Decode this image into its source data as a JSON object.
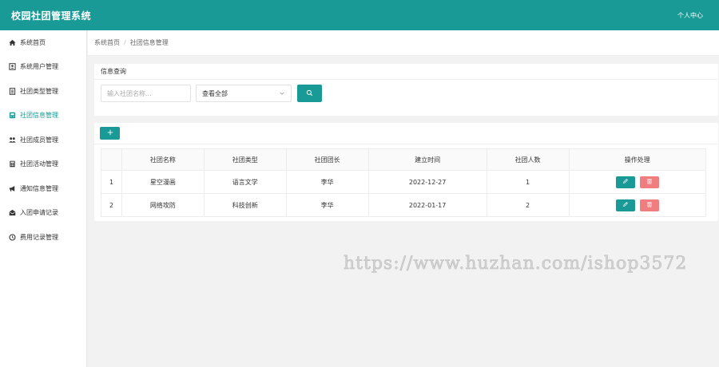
{
  "header": {
    "title": "校园社团管理系统",
    "user_link": "个人中心"
  },
  "sidebar": {
    "items": [
      {
        "label": "系统首页",
        "icon": "home-icon"
      },
      {
        "label": "系统用户管理",
        "icon": "user-card-icon"
      },
      {
        "label": "社团类型管理",
        "icon": "document-icon"
      },
      {
        "label": "社团信息管理",
        "icon": "info-icon",
        "active": true
      },
      {
        "label": "社团成员管理",
        "icon": "group-icon"
      },
      {
        "label": "社团活动管理",
        "icon": "calculator-icon"
      },
      {
        "label": "通知信息管理",
        "icon": "bullhorn-icon"
      },
      {
        "label": "入团申请记录",
        "icon": "envelope-icon"
      },
      {
        "label": "费用记录管理",
        "icon": "clock-icon"
      }
    ]
  },
  "breadcrumb": {
    "home": "系统首页",
    "separator": "/",
    "current": "社团信息管理"
  },
  "search": {
    "title": "信息查询",
    "input_placeholder": "输入社团名称...",
    "select_value": "查看全部"
  },
  "table": {
    "headers": [
      "社团名称",
      "社团类型",
      "社团团长",
      "建立时间",
      "社团人数",
      "操作处理"
    ],
    "rows": [
      {
        "index": "1",
        "name": "星空漫画",
        "type": "语言文学",
        "leader": "李华",
        "date": "2022-12-27",
        "count": "1"
      },
      {
        "index": "2",
        "name": "网络攻防",
        "type": "科技创新",
        "leader": "李华",
        "date": "2022-01-17",
        "count": "2"
      }
    ]
  },
  "watermark": "https://www.huzhan.com/ishop3572",
  "colors": {
    "primary": "#1a9a96",
    "danger": "#f07e7e",
    "background": "#f2f2f2"
  }
}
